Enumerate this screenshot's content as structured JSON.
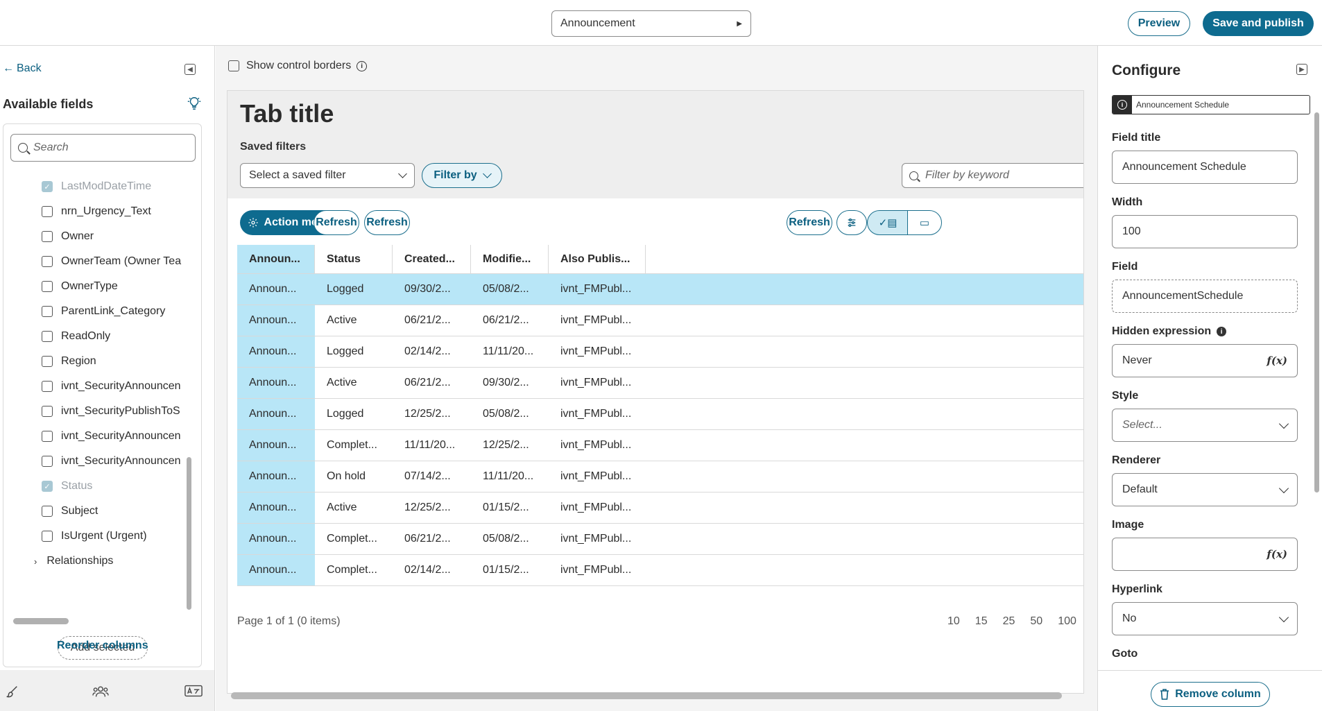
{
  "topbar": {
    "form_select": "Announcement",
    "preview_label": "Preview",
    "publish_label": "Save and publish"
  },
  "left_panel": {
    "back_label": "Back",
    "title": "Available fields",
    "search_placeholder": "Search",
    "fields": [
      {
        "label": "LastModDateTime",
        "checked": true,
        "disabled": true
      },
      {
        "label": "nrn_Urgency_Text",
        "checked": false,
        "disabled": false
      },
      {
        "label": "Owner",
        "checked": false,
        "disabled": false
      },
      {
        "label": "OwnerTeam (Owner Tea",
        "checked": false,
        "disabled": false
      },
      {
        "label": "OwnerType",
        "checked": false,
        "disabled": false
      },
      {
        "label": "ParentLink_Category",
        "checked": false,
        "disabled": false
      },
      {
        "label": "ReadOnly",
        "checked": false,
        "disabled": false
      },
      {
        "label": "Region",
        "checked": false,
        "disabled": false
      },
      {
        "label": "ivnt_SecurityAnnouncen",
        "checked": false,
        "disabled": false
      },
      {
        "label": "ivnt_SecurityPublishToS",
        "checked": false,
        "disabled": false
      },
      {
        "label": "ivnt_SecurityAnnouncen",
        "checked": false,
        "disabled": false
      },
      {
        "label": "ivnt_SecurityAnnouncen",
        "checked": false,
        "disabled": false
      },
      {
        "label": "Status",
        "checked": true,
        "disabled": true
      },
      {
        "label": "Subject",
        "checked": false,
        "disabled": false
      },
      {
        "label": "IsUrgent (Urgent)",
        "checked": false,
        "disabled": false
      }
    ],
    "relationships_label": "Relationships",
    "add_selected_label": "Add selected",
    "reorder_label": "Reorder columns"
  },
  "canvas": {
    "show_borders_label": "Show control borders",
    "tab_title": "Tab title",
    "saved_filters_label": "Saved filters",
    "saved_filter_placeholder": "Select a saved filter",
    "filter_by_label": "Filter by",
    "keyword_placeholder": "Filter by keyword",
    "action_menu_label": "Action menu",
    "refresh_1": "Refresh",
    "refresh_2": "Refresh",
    "refresh_3": "Refresh",
    "table": {
      "headers": [
        "Announ...",
        "Status",
        "Created...",
        "Modifie...",
        "Also Publis..."
      ],
      "rows": [
        [
          "Announ...",
          "Logged",
          "09/30/2...",
          "05/08/2...",
          "ivnt_FMPubl..."
        ],
        [
          "Announ...",
          "Active",
          "06/21/2...",
          "06/21/2...",
          "ivnt_FMPubl..."
        ],
        [
          "Announ...",
          "Logged",
          "02/14/2...",
          "11/11/20...",
          "ivnt_FMPubl..."
        ],
        [
          "Announ...",
          "Active",
          "06/21/2...",
          "09/30/2...",
          "ivnt_FMPubl..."
        ],
        [
          "Announ...",
          "Logged",
          "12/25/2...",
          "05/08/2...",
          "ivnt_FMPubl..."
        ],
        [
          "Announ...",
          "Complet...",
          "11/11/20...",
          "12/25/2...",
          "ivnt_FMPubl..."
        ],
        [
          "Announ...",
          "On hold",
          "07/14/2...",
          "11/11/20...",
          "ivnt_FMPubl..."
        ],
        [
          "Announ...",
          "Active",
          "12/25/2...",
          "01/15/2...",
          "ivnt_FMPubl..."
        ],
        [
          "Announ...",
          "Complet...",
          "06/21/2...",
          "05/08/2...",
          "ivnt_FMPubl..."
        ],
        [
          "Announ...",
          "Complet...",
          "02/14/2...",
          "01/15/2...",
          "ivnt_FMPubl..."
        ]
      ],
      "selected_row": 0
    },
    "pagination": "Page 1 of 1 (0 items)",
    "page_sizes": [
      "10",
      "15",
      "25",
      "50",
      "100"
    ]
  },
  "right_panel": {
    "title": "Configure",
    "badge": "Announcement Schedule",
    "field_title_label": "Field title",
    "field_title_value": "Announcement Schedule",
    "width_label": "Width",
    "width_value": "100",
    "field_label": "Field",
    "field_value": "AnnouncementSchedule",
    "hidden_label": "Hidden expression",
    "hidden_value": "Never",
    "style_label": "Style",
    "style_placeholder": "Select...",
    "renderer_label": "Renderer",
    "renderer_value": "Default",
    "image_label": "Image",
    "image_value": "",
    "hyperlink_label": "Hyperlink",
    "hyperlink_value": "No",
    "goto_label": "Goto",
    "fx_symbol": "f(x)",
    "remove_label": "Remove column"
  },
  "colors": {
    "accent": "#0e6b8f",
    "selected_row": "#b8e6f7"
  }
}
